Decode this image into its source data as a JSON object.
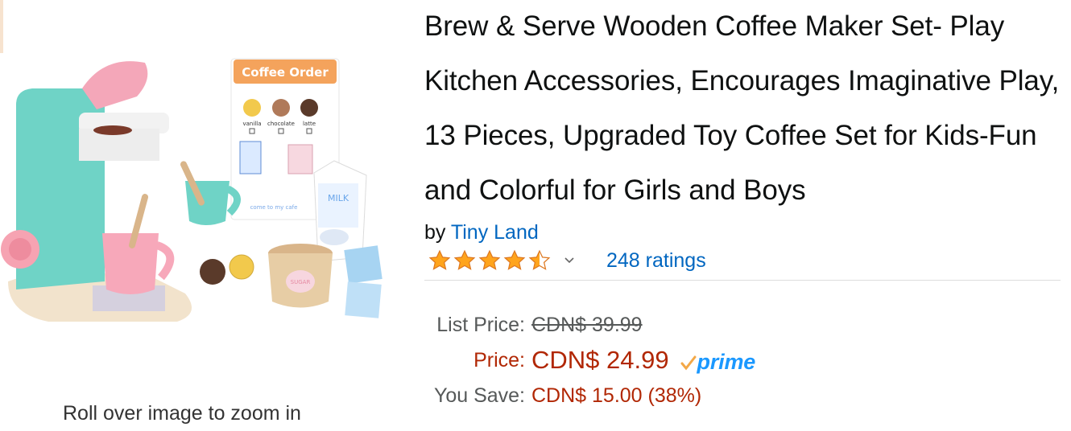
{
  "product": {
    "title": "Brew & Serve Wooden Coffee Maker Set- Play Kitchen Accessories, Encourages Imaginative Play, 13 Pieces, Upgraded Toy Coffee Set for Kids-Fun and Colorful for Girls and Boys",
    "by_prefix": "by",
    "brand": "Tiny Land",
    "rating_stars": 4.5,
    "ratings_text": "248 ratings"
  },
  "pricing": {
    "list_label": "List Price:",
    "list_value": "CDN$ 39.99",
    "price_label": "Price:",
    "price_value": "CDN$ 24.99",
    "prime_text": "prime",
    "save_label": "You Save:",
    "save_value": "CDN$ 15.00 (38%)"
  },
  "image": {
    "zoom_hint": "Roll over image to zoom in",
    "card_title": "Coffee Order",
    "card_options": [
      "vanilla",
      "chocolate",
      "latte"
    ],
    "card_footer": "come to my cafe",
    "milk_label": "MILK",
    "sugar_label": "SUGAR"
  },
  "colors": {
    "link": "#0066c0",
    "price": "#b12704",
    "star": "#ffa41c",
    "prime": "#1a98ff",
    "teal": "#6fd3c6",
    "pink": "#f4a7b9"
  },
  "icons": [
    "star-icon",
    "chevron-down-icon",
    "prime-check-icon"
  ]
}
